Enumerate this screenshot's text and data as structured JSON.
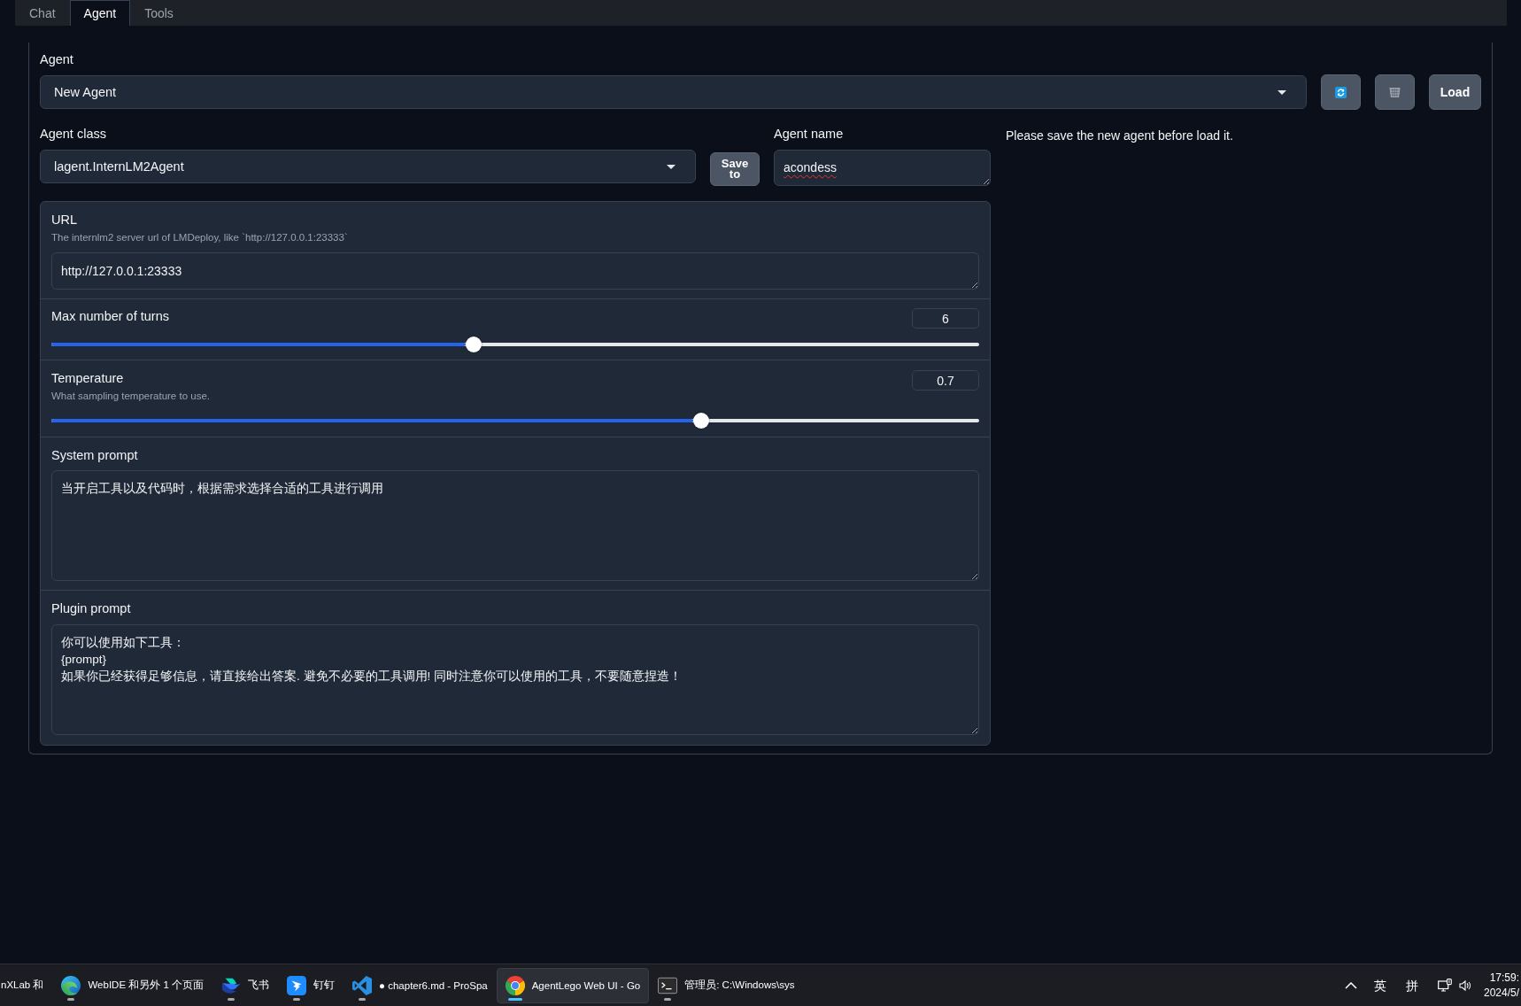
{
  "tabs": [
    {
      "label": "Chat",
      "selected": false
    },
    {
      "label": "Agent",
      "selected": true
    },
    {
      "label": "Tools",
      "selected": false
    }
  ],
  "agent": {
    "label": "Agent",
    "value": "New Agent",
    "buttons": [
      {
        "kind": "refresh"
      },
      {
        "kind": "delete"
      },
      {
        "kind": "text",
        "label": "Load"
      }
    ]
  },
  "agent_class": {
    "label": "Agent class",
    "value": "lagent.InternLM2Agent",
    "button": "Save to"
  },
  "agent_name": {
    "label": "Agent name",
    "value": "acondess",
    "misspelled": true
  },
  "message": "Please save the new agent before load it.",
  "settings": [
    {
      "kind": "text",
      "label": "URL",
      "info": "The internlm2 server url of LMDeploy, like `http://127.0.0.1:23333`",
      "value": "http://127.0.0.1:23333"
    },
    {
      "kind": "slider",
      "label": "Max number of turns",
      "value": "6",
      "level": 0.455
    },
    {
      "kind": "slider",
      "label": "Temperature",
      "info": "What sampling temperature to use.",
      "value": "0.7",
      "level": 0.7
    },
    {
      "kind": "textarea",
      "label": "System prompt",
      "value": "当开启工具以及代码时，根据需求选择合适的工具进行调用"
    },
    {
      "kind": "textarea",
      "label": "Plugin prompt",
      "value": "你可以使用如下工具：\n{prompt}\n如果你已经获得足够信息，请直接给出答案. 避免不必要的工具调用! 同时注意你可以使用的工具，不要随意捏造！"
    }
  ],
  "taskbar": {
    "items": [
      {
        "kind": "none",
        "label": "nXLab 和",
        "running": false,
        "selected": false
      },
      {
        "kind": "swirl",
        "label": "WebIDE 和另外 1 个页面",
        "running": true,
        "selected": false
      },
      {
        "kind": "bird",
        "label": "飞书",
        "running": true,
        "selected": false
      },
      {
        "kind": "tile",
        "label": "钉钉",
        "running": true,
        "selected": false
      },
      {
        "kind": "code",
        "label": "● chapter6.md - ProSpa",
        "running": true,
        "selected": false
      },
      {
        "kind": "wheel",
        "label": "AgentLego Web UI - Go",
        "running": true,
        "selected": true
      },
      {
        "kind": "terminal",
        "label": "管理员: C:\\Windows\\sys",
        "running": true,
        "selected": false
      }
    ],
    "tray": {
      "input_language": "英",
      "input_mode": "拼",
      "time": "17:59:",
      "date": "2024/5/"
    }
  }
}
